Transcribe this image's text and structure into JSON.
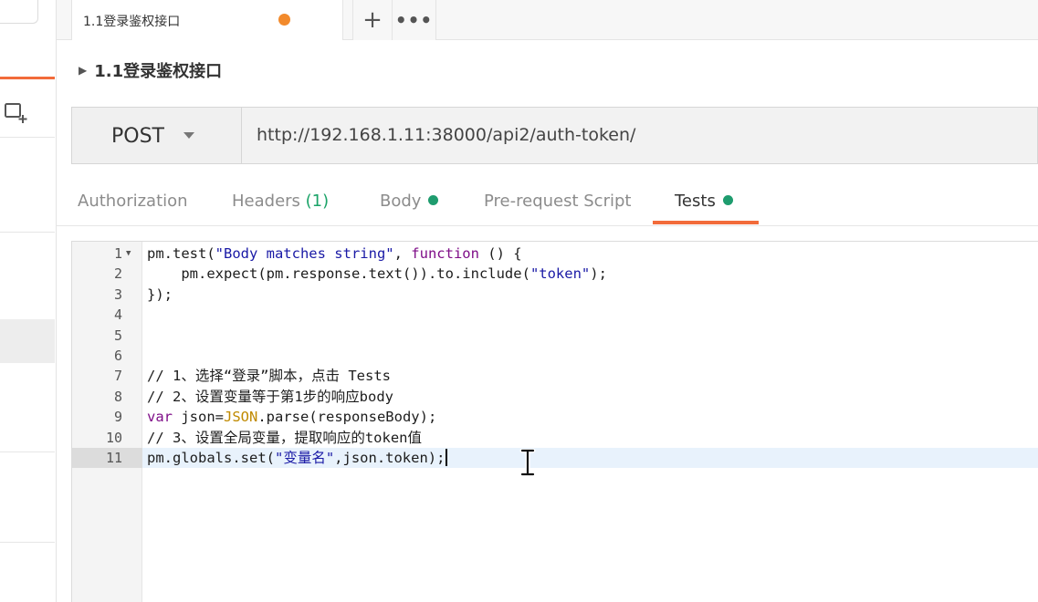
{
  "tab": {
    "title": "1.1登录鉴权接口",
    "add_glyph": "+",
    "more_glyph": "•••"
  },
  "breadcrumb": {
    "name": "1.1登录鉴权接口"
  },
  "request": {
    "method": "POST",
    "url": "http://192.168.1.11:38000/api2/auth-token/"
  },
  "request_tabs": [
    {
      "label": "Authorization"
    },
    {
      "label": "Headers",
      "count": "(1)"
    },
    {
      "label": "Body",
      "has_dot": true
    },
    {
      "label": "Pre-request Script"
    },
    {
      "label": "Tests",
      "has_dot": true,
      "active": true
    }
  ],
  "editor": {
    "lines": [
      {
        "n": "1",
        "text": "pm.test(\"Body matches string\", function () {"
      },
      {
        "n": "2",
        "text": "    pm.expect(pm.response.text()).to.include(\"token\");"
      },
      {
        "n": "3",
        "text": "});"
      },
      {
        "n": "4",
        "text": ""
      },
      {
        "n": "5",
        "text": ""
      },
      {
        "n": "6",
        "text": ""
      },
      {
        "n": "7",
        "text": "// 1、选择“登录”脚本，点击 Tests"
      },
      {
        "n": "8",
        "text": "// 2、设置变量等于第1步的响应body"
      },
      {
        "n": "9",
        "text": "var json=JSON.parse(responseBody);"
      },
      {
        "n": "10",
        "text": "// 3、设置全局变量，提取响应的token值"
      },
      {
        "n": "11",
        "text": "pm.globals.set(\"变量名\",json.token);"
      }
    ]
  },
  "colors": {
    "accent": "#f26b3a",
    "unsaved_dot": "#f28a2c",
    "status_green": "#1e9c6e"
  }
}
